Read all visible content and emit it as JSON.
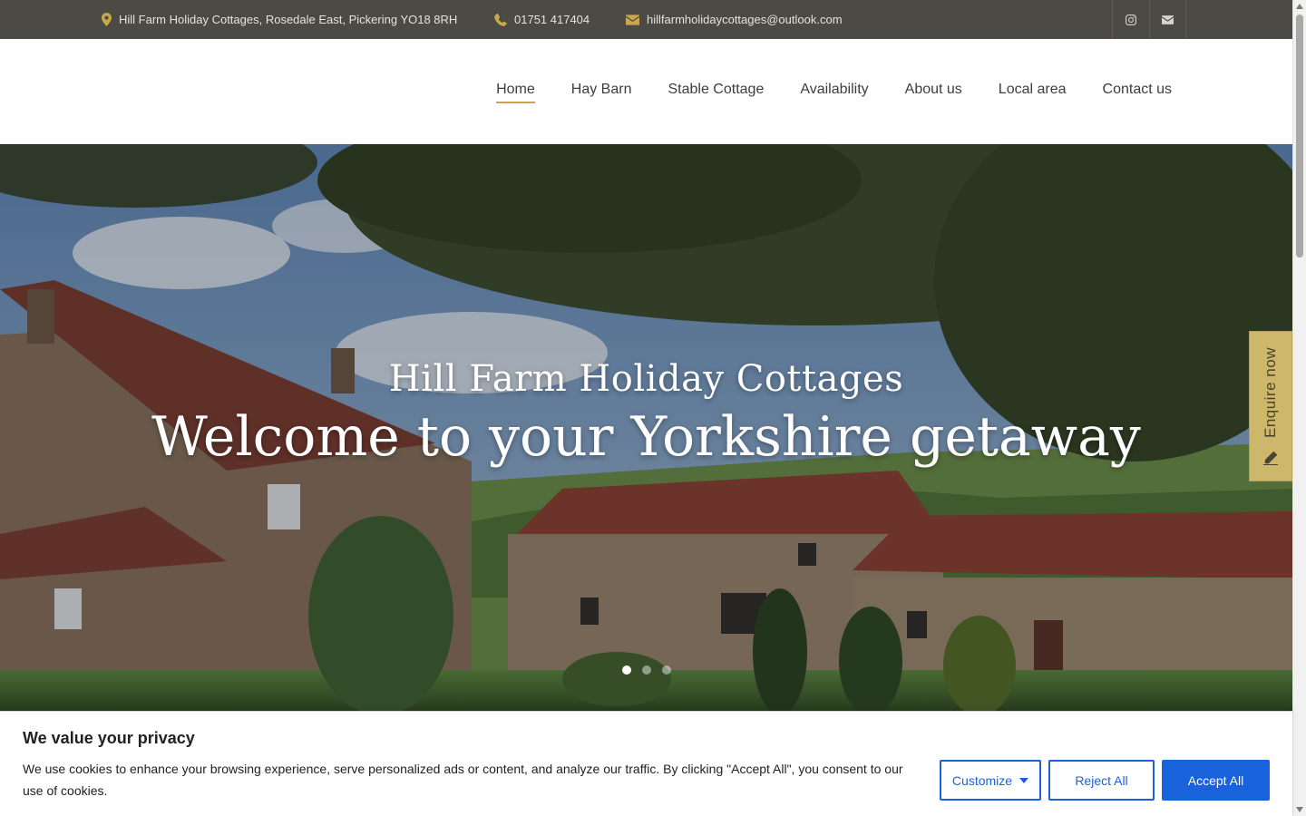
{
  "topbar": {
    "address": "Hill Farm Holiday Cottages, Rosedale East, Pickering YO18 8RH",
    "phone": "01751 417404",
    "email": "hillfarmholidaycottages@outlook.com",
    "social_icons": [
      "instagram-icon",
      "mail-icon"
    ]
  },
  "nav": {
    "items": [
      {
        "label": "Home",
        "active": true
      },
      {
        "label": "Hay Barn",
        "active": false
      },
      {
        "label": "Stable Cottage",
        "active": false
      },
      {
        "label": "Availability",
        "active": false
      },
      {
        "label": "About us",
        "active": false
      },
      {
        "label": "Local area",
        "active": false
      },
      {
        "label": "Contact us",
        "active": false
      }
    ]
  },
  "hero": {
    "subtitle": "Hill Farm Holiday Cottages",
    "title": "Welcome to your Yorkshire getaway",
    "slides_total": 3,
    "active_slide": 1
  },
  "enquire": {
    "label": "Enquire now",
    "icon": "pencil-icon"
  },
  "cookie": {
    "heading": "We value your privacy",
    "text": "We use cookies to enhance your browsing experience, serve personalized ads or content, and analyze our traffic. By clicking \"Accept All\", you consent to our use of cookies.",
    "customize_label": "Customize",
    "reject_label": "Reject All",
    "accept_label": "Accept All"
  },
  "colors": {
    "topbar_bg": "#4c4a45",
    "accent_gold": "#c9a84a",
    "enquire_bg": "#cdb76a",
    "button_blue": "#1863dc"
  }
}
